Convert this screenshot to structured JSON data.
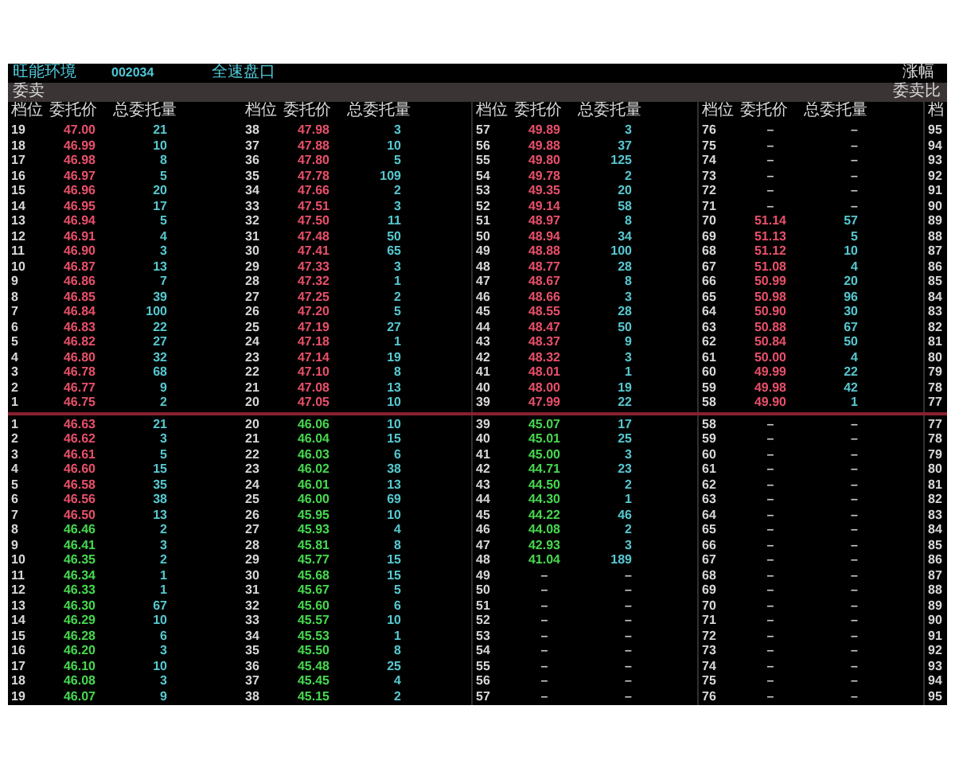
{
  "header": {
    "stock_name": "旺能环境",
    "stock_code": "002034",
    "title": "全速盘口",
    "right_label": "涨幅"
  },
  "section_bar": {
    "left_label": "委卖",
    "right_label": "委卖比"
  },
  "column_groups": [
    {
      "headers": [
        "档位",
        "委托价",
        "总委托量"
      ]
    },
    {
      "headers": [
        "档位",
        "委托价",
        "总委托量"
      ]
    },
    {
      "headers": [
        "档位",
        "委托价",
        "总委托量"
      ]
    },
    {
      "headers": [
        "档位",
        "委托价",
        "总委托量"
      ]
    },
    {
      "headers": [
        "档"
      ]
    }
  ],
  "sell_columns": [
    {
      "rows": [
        {
          "level": "19",
          "price": "47.00",
          "volume": "21",
          "color": "#e8506a"
        },
        {
          "level": "18",
          "price": "46.99",
          "volume": "10",
          "color": "#e8506a"
        },
        {
          "level": "17",
          "price": "46.98",
          "volume": "8",
          "color": "#e8506a"
        },
        {
          "level": "16",
          "price": "46.97",
          "volume": "5",
          "color": "#e8506a"
        },
        {
          "level": "15",
          "price": "46.96",
          "volume": "20",
          "color": "#e8506a"
        },
        {
          "level": "14",
          "price": "46.95",
          "volume": "17",
          "color": "#e8506a"
        },
        {
          "level": "13",
          "price": "46.94",
          "volume": "5",
          "color": "#e8506a"
        },
        {
          "level": "12",
          "price": "46.91",
          "volume": "4",
          "color": "#e8506a"
        },
        {
          "level": "11",
          "price": "46.90",
          "volume": "3",
          "color": "#e8506a"
        },
        {
          "level": "10",
          "price": "46.87",
          "volume": "13",
          "color": "#e8506a"
        },
        {
          "level": "9",
          "price": "46.86",
          "volume": "7",
          "color": "#e8506a"
        },
        {
          "level": "8",
          "price": "46.85",
          "volume": "39",
          "color": "#e8506a"
        },
        {
          "level": "7",
          "price": "46.84",
          "volume": "100",
          "color": "#e8506a"
        },
        {
          "level": "6",
          "price": "46.83",
          "volume": "22",
          "color": "#e8506a"
        },
        {
          "level": "5",
          "price": "46.82",
          "volume": "27",
          "color": "#e8506a"
        },
        {
          "level": "4",
          "price": "46.80",
          "volume": "32",
          "color": "#e8506a"
        },
        {
          "level": "3",
          "price": "46.78",
          "volume": "68",
          "color": "#e8506a"
        },
        {
          "level": "2",
          "price": "46.77",
          "volume": "9",
          "color": "#e8506a"
        },
        {
          "level": "1",
          "price": "46.75",
          "volume": "2",
          "color": "#e8506a"
        }
      ]
    },
    {
      "rows": [
        {
          "level": "38",
          "price": "47.98",
          "volume": "3",
          "color": "#e8506a"
        },
        {
          "level": "37",
          "price": "47.88",
          "volume": "10",
          "color": "#e8506a"
        },
        {
          "level": "36",
          "price": "47.80",
          "volume": "5",
          "color": "#e8506a"
        },
        {
          "level": "35",
          "price": "47.78",
          "volume": "109",
          "color": "#e8506a"
        },
        {
          "level": "34",
          "price": "47.66",
          "volume": "2",
          "color": "#e8506a"
        },
        {
          "level": "33",
          "price": "47.51",
          "volume": "3",
          "color": "#e8506a"
        },
        {
          "level": "32",
          "price": "47.50",
          "volume": "11",
          "color": "#e8506a"
        },
        {
          "level": "31",
          "price": "47.48",
          "volume": "50",
          "color": "#e8506a"
        },
        {
          "level": "30",
          "price": "47.41",
          "volume": "65",
          "color": "#e8506a"
        },
        {
          "level": "29",
          "price": "47.33",
          "volume": "3",
          "color": "#e8506a"
        },
        {
          "level": "28",
          "price": "47.32",
          "volume": "1",
          "color": "#e8506a"
        },
        {
          "level": "27",
          "price": "47.25",
          "volume": "2",
          "color": "#e8506a"
        },
        {
          "level": "26",
          "price": "47.20",
          "volume": "5",
          "color": "#e8506a"
        },
        {
          "level": "25",
          "price": "47.19",
          "volume": "27",
          "color": "#e8506a"
        },
        {
          "level": "24",
          "price": "47.18",
          "volume": "1",
          "color": "#e8506a"
        },
        {
          "level": "23",
          "price": "47.14",
          "volume": "19",
          "color": "#e8506a"
        },
        {
          "level": "22",
          "price": "47.10",
          "volume": "8",
          "color": "#e8506a"
        },
        {
          "level": "21",
          "price": "47.08",
          "volume": "13",
          "color": "#e8506a"
        },
        {
          "level": "20",
          "price": "47.05",
          "volume": "10",
          "color": "#e8506a"
        }
      ]
    },
    {
      "rows": [
        {
          "level": "57",
          "price": "49.89",
          "volume": "3",
          "color": "#e8506a"
        },
        {
          "level": "56",
          "price": "49.88",
          "volume": "37",
          "color": "#e8506a"
        },
        {
          "level": "55",
          "price": "49.80",
          "volume": "125",
          "color": "#e8506a"
        },
        {
          "level": "54",
          "price": "49.78",
          "volume": "2",
          "color": "#e8506a"
        },
        {
          "level": "53",
          "price": "49.35",
          "volume": "20",
          "color": "#e8506a"
        },
        {
          "level": "52",
          "price": "49.14",
          "volume": "58",
          "color": "#e8506a"
        },
        {
          "level": "51",
          "price": "48.97",
          "volume": "8",
          "color": "#e8506a"
        },
        {
          "level": "50",
          "price": "48.94",
          "volume": "34",
          "color": "#e8506a"
        },
        {
          "level": "49",
          "price": "48.88",
          "volume": "100",
          "color": "#e8506a"
        },
        {
          "level": "48",
          "price": "48.77",
          "volume": "28",
          "color": "#e8506a"
        },
        {
          "level": "47",
          "price": "48.67",
          "volume": "8",
          "color": "#e8506a"
        },
        {
          "level": "46",
          "price": "48.66",
          "volume": "3",
          "color": "#e8506a"
        },
        {
          "level": "45",
          "price": "48.55",
          "volume": "28",
          "color": "#e8506a"
        },
        {
          "level": "44",
          "price": "48.47",
          "volume": "50",
          "color": "#e8506a"
        },
        {
          "level": "43",
          "price": "48.37",
          "volume": "9",
          "color": "#e8506a"
        },
        {
          "level": "42",
          "price": "48.32",
          "volume": "3",
          "color": "#e8506a"
        },
        {
          "level": "41",
          "price": "48.01",
          "volume": "1",
          "color": "#e8506a"
        },
        {
          "level": "40",
          "price": "48.00",
          "volume": "19",
          "color": "#e8506a"
        },
        {
          "level": "39",
          "price": "47.99",
          "volume": "22",
          "color": "#e8506a"
        }
      ]
    },
    {
      "rows": [
        {
          "level": "76",
          "price": "–",
          "volume": "–"
        },
        {
          "level": "75",
          "price": "–",
          "volume": "–"
        },
        {
          "level": "74",
          "price": "–",
          "volume": "–"
        },
        {
          "level": "73",
          "price": "–",
          "volume": "–"
        },
        {
          "level": "72",
          "price": "–",
          "volume": "–"
        },
        {
          "level": "71",
          "price": "–",
          "volume": "–"
        },
        {
          "level": "70",
          "price": "51.14",
          "volume": "57",
          "color": "#e8506a"
        },
        {
          "level": "69",
          "price": "51.13",
          "volume": "5",
          "color": "#e8506a"
        },
        {
          "level": "68",
          "price": "51.12",
          "volume": "10",
          "color": "#e8506a"
        },
        {
          "level": "67",
          "price": "51.08",
          "volume": "4",
          "color": "#e8506a"
        },
        {
          "level": "66",
          "price": "50.99",
          "volume": "20",
          "color": "#e8506a"
        },
        {
          "level": "65",
          "price": "50.98",
          "volume": "96",
          "color": "#e8506a"
        },
        {
          "level": "64",
          "price": "50.90",
          "volume": "30",
          "color": "#e8506a"
        },
        {
          "level": "63",
          "price": "50.88",
          "volume": "67",
          "color": "#e8506a"
        },
        {
          "level": "62",
          "price": "50.84",
          "volume": "50",
          "color": "#e8506a"
        },
        {
          "level": "61",
          "price": "50.00",
          "volume": "4",
          "color": "#e8506a"
        },
        {
          "level": "60",
          "price": "49.99",
          "volume": "22",
          "color": "#e8506a"
        },
        {
          "level": "59",
          "price": "49.98",
          "volume": "42",
          "color": "#e8506a"
        },
        {
          "level": "58",
          "price": "49.90",
          "volume": "1",
          "color": "#e8506a"
        }
      ]
    },
    {
      "rows": [
        {
          "level": "95"
        },
        {
          "level": "94"
        },
        {
          "level": "93"
        },
        {
          "level": "92"
        },
        {
          "level": "91"
        },
        {
          "level": "90"
        },
        {
          "level": "89"
        },
        {
          "level": "88"
        },
        {
          "level": "87"
        },
        {
          "level": "86"
        },
        {
          "level": "85"
        },
        {
          "level": "84"
        },
        {
          "level": "83"
        },
        {
          "level": "82"
        },
        {
          "level": "81"
        },
        {
          "level": "80"
        },
        {
          "level": "79"
        },
        {
          "level": "78"
        },
        {
          "level": "77"
        }
      ]
    }
  ],
  "buy_columns": [
    {
      "rows": [
        {
          "level": "1",
          "price": "46.63",
          "volume": "21",
          "color": "#e8506a"
        },
        {
          "level": "2",
          "price": "46.62",
          "volume": "3",
          "color": "#e8506a"
        },
        {
          "level": "3",
          "price": "46.61",
          "volume": "5",
          "color": "#e8506a"
        },
        {
          "level": "4",
          "price": "46.60",
          "volume": "15",
          "color": "#e8506a"
        },
        {
          "level": "5",
          "price": "46.58",
          "volume": "35",
          "color": "#e8506a"
        },
        {
          "level": "6",
          "price": "46.56",
          "volume": "38",
          "color": "#e8506a"
        },
        {
          "level": "7",
          "price": "46.50",
          "volume": "13",
          "color": "#e8506a"
        },
        {
          "level": "8",
          "price": "46.46",
          "volume": "2",
          "color": "#46d84e"
        },
        {
          "level": "9",
          "price": "46.41",
          "volume": "3",
          "color": "#46d84e"
        },
        {
          "level": "10",
          "price": "46.35",
          "volume": "2",
          "color": "#46d84e"
        },
        {
          "level": "11",
          "price": "46.34",
          "volume": "1",
          "color": "#46d84e"
        },
        {
          "level": "12",
          "price": "46.33",
          "volume": "1",
          "color": "#46d84e"
        },
        {
          "level": "13",
          "price": "46.30",
          "volume": "67",
          "color": "#46d84e"
        },
        {
          "level": "14",
          "price": "46.29",
          "volume": "10",
          "color": "#46d84e"
        },
        {
          "level": "15",
          "price": "46.28",
          "volume": "6",
          "color": "#46d84e"
        },
        {
          "level": "16",
          "price": "46.20",
          "volume": "3",
          "color": "#46d84e"
        },
        {
          "level": "17",
          "price": "46.10",
          "volume": "10",
          "color": "#46d84e"
        },
        {
          "level": "18",
          "price": "46.08",
          "volume": "3",
          "color": "#46d84e"
        },
        {
          "level": "19",
          "price": "46.07",
          "volume": "9",
          "color": "#46d84e"
        }
      ]
    },
    {
      "rows": [
        {
          "level": "20",
          "price": "46.06",
          "volume": "10",
          "color": "#46d84e"
        },
        {
          "level": "21",
          "price": "46.04",
          "volume": "15",
          "color": "#46d84e"
        },
        {
          "level": "22",
          "price": "46.03",
          "volume": "6",
          "color": "#46d84e"
        },
        {
          "level": "23",
          "price": "46.02",
          "volume": "38",
          "color": "#46d84e"
        },
        {
          "level": "24",
          "price": "46.01",
          "volume": "13",
          "color": "#46d84e"
        },
        {
          "level": "25",
          "price": "46.00",
          "volume": "69",
          "color": "#46d84e"
        },
        {
          "level": "26",
          "price": "45.95",
          "volume": "10",
          "color": "#46d84e"
        },
        {
          "level": "27",
          "price": "45.93",
          "volume": "4",
          "color": "#46d84e"
        },
        {
          "level": "28",
          "price": "45.81",
          "volume": "8",
          "color": "#46d84e"
        },
        {
          "level": "29",
          "price": "45.77",
          "volume": "15",
          "color": "#46d84e"
        },
        {
          "level": "30",
          "price": "45.68",
          "volume": "15",
          "color": "#46d84e"
        },
        {
          "level": "31",
          "price": "45.67",
          "volume": "5",
          "color": "#46d84e"
        },
        {
          "level": "32",
          "price": "45.60",
          "volume": "6",
          "color": "#46d84e"
        },
        {
          "level": "33",
          "price": "45.57",
          "volume": "10",
          "color": "#46d84e"
        },
        {
          "level": "34",
          "price": "45.53",
          "volume": "1",
          "color": "#46d84e"
        },
        {
          "level": "35",
          "price": "45.50",
          "volume": "8",
          "color": "#46d84e"
        },
        {
          "level": "36",
          "price": "45.48",
          "volume": "25",
          "color": "#46d84e"
        },
        {
          "level": "37",
          "price": "45.45",
          "volume": "4",
          "color": "#46d84e"
        },
        {
          "level": "38",
          "price": "45.15",
          "volume": "2",
          "color": "#46d84e"
        }
      ]
    },
    {
      "rows": [
        {
          "level": "39",
          "price": "45.07",
          "volume": "17",
          "color": "#46d84e"
        },
        {
          "level": "40",
          "price": "45.01",
          "volume": "25",
          "color": "#46d84e"
        },
        {
          "level": "41",
          "price": "45.00",
          "volume": "3",
          "color": "#46d84e"
        },
        {
          "level": "42",
          "price": "44.71",
          "volume": "23",
          "color": "#46d84e"
        },
        {
          "level": "43",
          "price": "44.50",
          "volume": "2",
          "color": "#46d84e"
        },
        {
          "level": "44",
          "price": "44.30",
          "volume": "1",
          "color": "#46d84e"
        },
        {
          "level": "45",
          "price": "44.22",
          "volume": "46",
          "color": "#46d84e"
        },
        {
          "level": "46",
          "price": "44.08",
          "volume": "2",
          "color": "#46d84e"
        },
        {
          "level": "47",
          "price": "42.93",
          "volume": "3",
          "color": "#46d84e"
        },
        {
          "level": "48",
          "price": "41.04",
          "volume": "189",
          "color": "#46d84e"
        },
        {
          "level": "49",
          "price": "–",
          "volume": "–"
        },
        {
          "level": "50",
          "price": "–",
          "volume": "–"
        },
        {
          "level": "51",
          "price": "–",
          "volume": "–"
        },
        {
          "level": "52",
          "price": "–",
          "volume": "–"
        },
        {
          "level": "53",
          "price": "–",
          "volume": "–"
        },
        {
          "level": "54",
          "price": "–",
          "volume": "–"
        },
        {
          "level": "55",
          "price": "–",
          "volume": "–"
        },
        {
          "level": "56",
          "price": "–",
          "volume": "–"
        },
        {
          "level": "57",
          "price": "–",
          "volume": "–"
        }
      ]
    },
    {
      "rows": [
        {
          "level": "58",
          "price": "–",
          "volume": "–"
        },
        {
          "level": "59",
          "price": "–",
          "volume": "–"
        },
        {
          "level": "60",
          "price": "–",
          "volume": "–"
        },
        {
          "level": "61",
          "price": "–",
          "volume": "–"
        },
        {
          "level": "62",
          "price": "–",
          "volume": "–"
        },
        {
          "level": "63",
          "price": "–",
          "volume": "–"
        },
        {
          "level": "64",
          "price": "–",
          "volume": "–"
        },
        {
          "level": "65",
          "price": "–",
          "volume": "–"
        },
        {
          "level": "66",
          "price": "–",
          "volume": "–"
        },
        {
          "level": "67",
          "price": "–",
          "volume": "–"
        },
        {
          "level": "68",
          "price": "–",
          "volume": "–"
        },
        {
          "level": "69",
          "price": "–",
          "volume": "–"
        },
        {
          "level": "70",
          "price": "–",
          "volume": "–"
        },
        {
          "level": "71",
          "price": "–",
          "volume": "–"
        },
        {
          "level": "72",
          "price": "–",
          "volume": "–"
        },
        {
          "level": "73",
          "price": "–",
          "volume": "–"
        },
        {
          "level": "74",
          "price": "–",
          "volume": "–"
        },
        {
          "level": "75",
          "price": "–",
          "volume": "–"
        },
        {
          "level": "76",
          "price": "–",
          "volume": "–"
        }
      ]
    },
    {
      "rows": [
        {
          "level": "77"
        },
        {
          "level": "78"
        },
        {
          "level": "79"
        },
        {
          "level": "80"
        },
        {
          "level": "81"
        },
        {
          "level": "82"
        },
        {
          "level": "83"
        },
        {
          "level": "84"
        },
        {
          "level": "85"
        },
        {
          "level": "86"
        },
        {
          "level": "87"
        },
        {
          "level": "88"
        },
        {
          "level": "89"
        },
        {
          "level": "90"
        },
        {
          "level": "91"
        },
        {
          "level": "92"
        },
        {
          "level": "93"
        },
        {
          "level": "94"
        },
        {
          "level": "95"
        }
      ]
    }
  ]
}
